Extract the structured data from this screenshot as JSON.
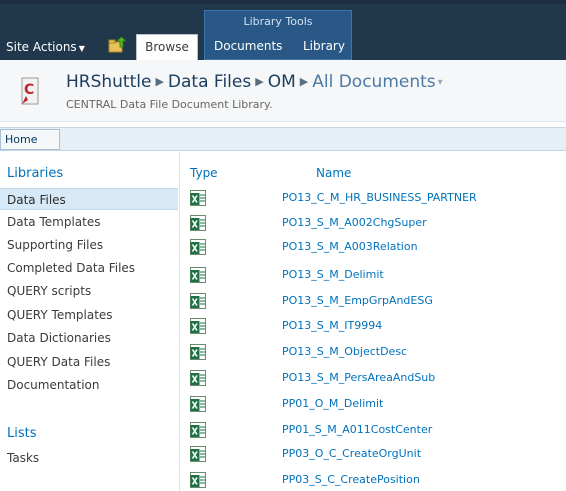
{
  "ribbon": {
    "site_actions": "Site Actions",
    "browse_tab": "Browse",
    "library_tools_title": "Library Tools",
    "documents_tab": "Documents",
    "library_tab": "Library"
  },
  "title": {
    "breadcrumb": [
      "HRShuttle",
      "Data Files",
      "OM",
      "All Documents"
    ],
    "subtitle": "CENTRAL Data File Document Library."
  },
  "topbar": {
    "home": "Home"
  },
  "leftnav": {
    "libraries_heading": "Libraries",
    "libraries": [
      "Data Files",
      "Data Templates",
      "Supporting Files",
      "Completed Data Files",
      "QUERY scripts",
      "QUERY Templates",
      "Data Dictionaries",
      "QUERY Data Files",
      "Documentation"
    ],
    "lists_heading": "Lists",
    "lists": [
      "Tasks"
    ]
  },
  "list": {
    "columns": [
      "Type",
      "Name"
    ],
    "rows": [
      "PO13_C_M_HR_BUSINESS_PARTNER",
      "PO13_S_M_A002ChgSuper",
      "PO13_S_M_A003Relation",
      "PO13_S_M_Delimit",
      "PO13_S_M_EmpGrpAndESG",
      "PO13_S_M_IT9994",
      "PO13_S_M_ObjectDesc",
      "PO13_S_M_PersAreaAndSub",
      "PP01_O_M_Delimit",
      "PP01_S_M_A011CostCenter",
      "PP03_O_C_CreateOrgUnit",
      "PP03_S_C_CreatePosition"
    ]
  },
  "colors": {
    "ribbon": "#21374c",
    "library_tools": "#2a5886",
    "link": "#0072bc",
    "selected_nav": "#d7e8f7",
    "excel_green": "#1e7145"
  }
}
